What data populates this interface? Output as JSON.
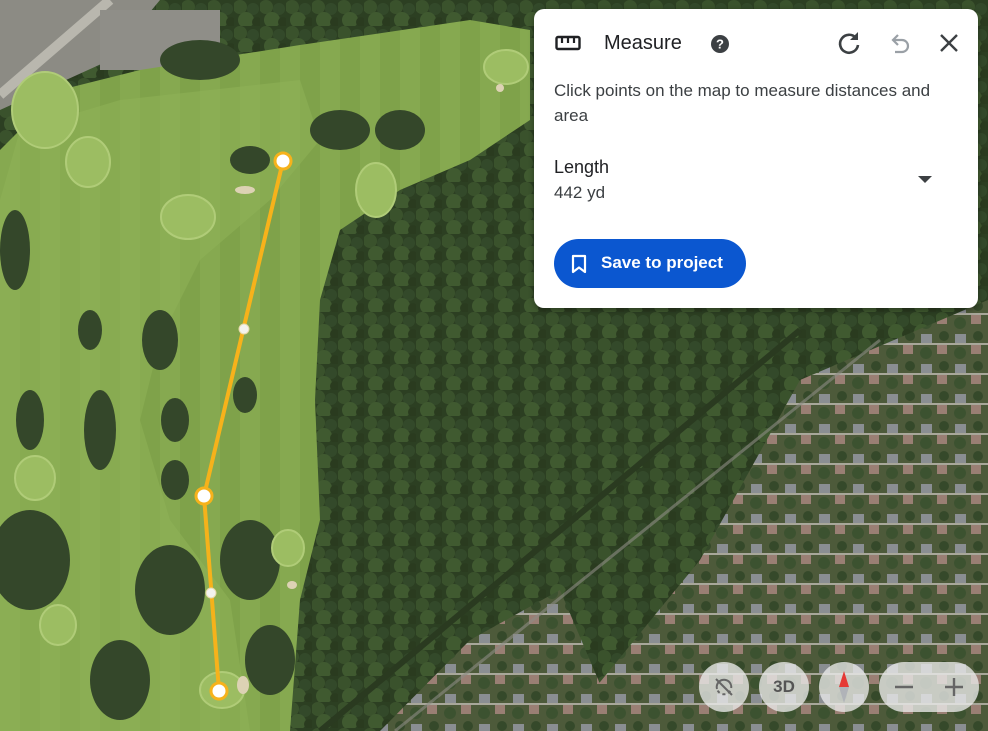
{
  "panel": {
    "title": "Measure",
    "instructions": "Click points on the map to measure distances and area",
    "length_label": "Length",
    "length_value": "442 yd",
    "save_label": "Save to project"
  },
  "icons": {
    "ruler": "ruler-icon",
    "help": "help-icon",
    "redo": "redo-icon",
    "undo": "undo-icon",
    "close": "close-icon",
    "dropdown": "dropdown-arrow-icon",
    "bookmark": "bookmark-icon",
    "rotate": "tilt-off-icon",
    "compass": "compass-icon",
    "zoom_out": "minus-icon",
    "zoom_in": "plus-icon"
  },
  "controls": {
    "three_d_label": "3D"
  },
  "colors": {
    "accent": "#0b57d0",
    "measure_line": "#f6b21b",
    "panel_bg": "#ffffff"
  }
}
